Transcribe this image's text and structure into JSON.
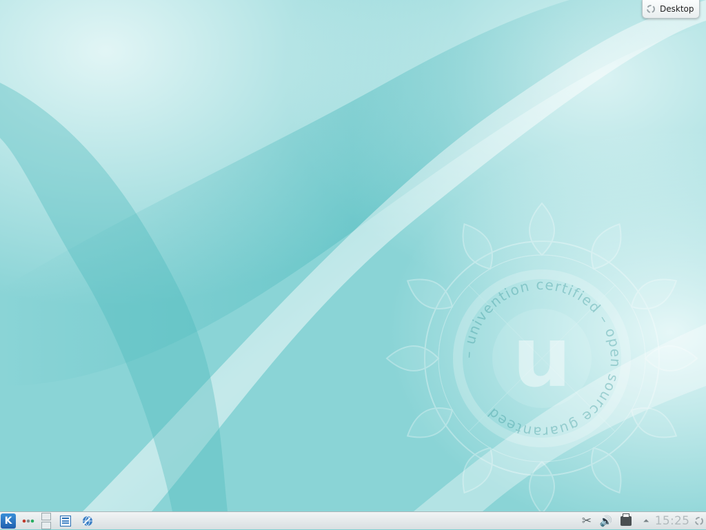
{
  "desktop": {
    "wallpaper": {
      "colors": {
        "base": "#7fd0d3",
        "highlight": "#dff4f4",
        "deep": "#3fb4b8"
      },
      "logo": {
        "letter": "u",
        "text": "– univention certified – open source guaranteed"
      }
    },
    "toolbox": {
      "label": "Desktop",
      "icon": "cashew-icon"
    }
  },
  "taskbar": {
    "left": [
      {
        "name": "kickoff-launcher",
        "icon": "kde-logo-icon",
        "glyph": "K"
      },
      {
        "name": "activities-button",
        "icon": "activities-dots-icon"
      },
      {
        "name": "desktop-pager",
        "icon": "pager-icon"
      },
      {
        "name": "task-manager",
        "icon": "window-list-icon"
      },
      {
        "name": "quick-launcher",
        "icon": "globe-app-icon"
      }
    ],
    "tray": {
      "icons": [
        "scissors-icon",
        "speaker-icon",
        "printer-icon",
        "expand-arrow-icon"
      ],
      "scissors_glyph": "✂",
      "volume_glyph": "🔊",
      "arrow_glyph": "⏶"
    },
    "clock": "15:25"
  }
}
